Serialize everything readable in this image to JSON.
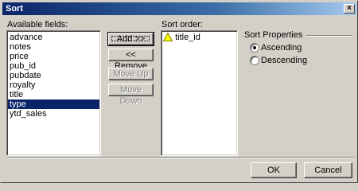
{
  "window": {
    "title": "Sort",
    "close_glyph": "×"
  },
  "available": {
    "label": "Available fields:",
    "items": [
      "advance",
      "notes",
      "price",
      "pub_id",
      "pubdate",
      "royalty",
      "title",
      "type",
      "ytd_sales"
    ],
    "selected_index": 7
  },
  "buttons": {
    "add": "Add >>",
    "remove": "<< Remove",
    "move_up": "Move Up",
    "move_down": "Move Down",
    "ok": "OK",
    "cancel": "Cancel"
  },
  "sort_order": {
    "label": "Sort order:",
    "items": [
      {
        "name": "title_id",
        "icon": "warning-triangle-icon"
      }
    ]
  },
  "sort_properties": {
    "label": "Sort Properties",
    "options": [
      {
        "label": "Ascending",
        "checked": true
      },
      {
        "label": "Descending",
        "checked": false
      }
    ]
  },
  "colors": {
    "selection": "#0a246a",
    "title_start": "#0a246a",
    "title_end": "#a6caf0",
    "face": "#d4d0c8"
  }
}
